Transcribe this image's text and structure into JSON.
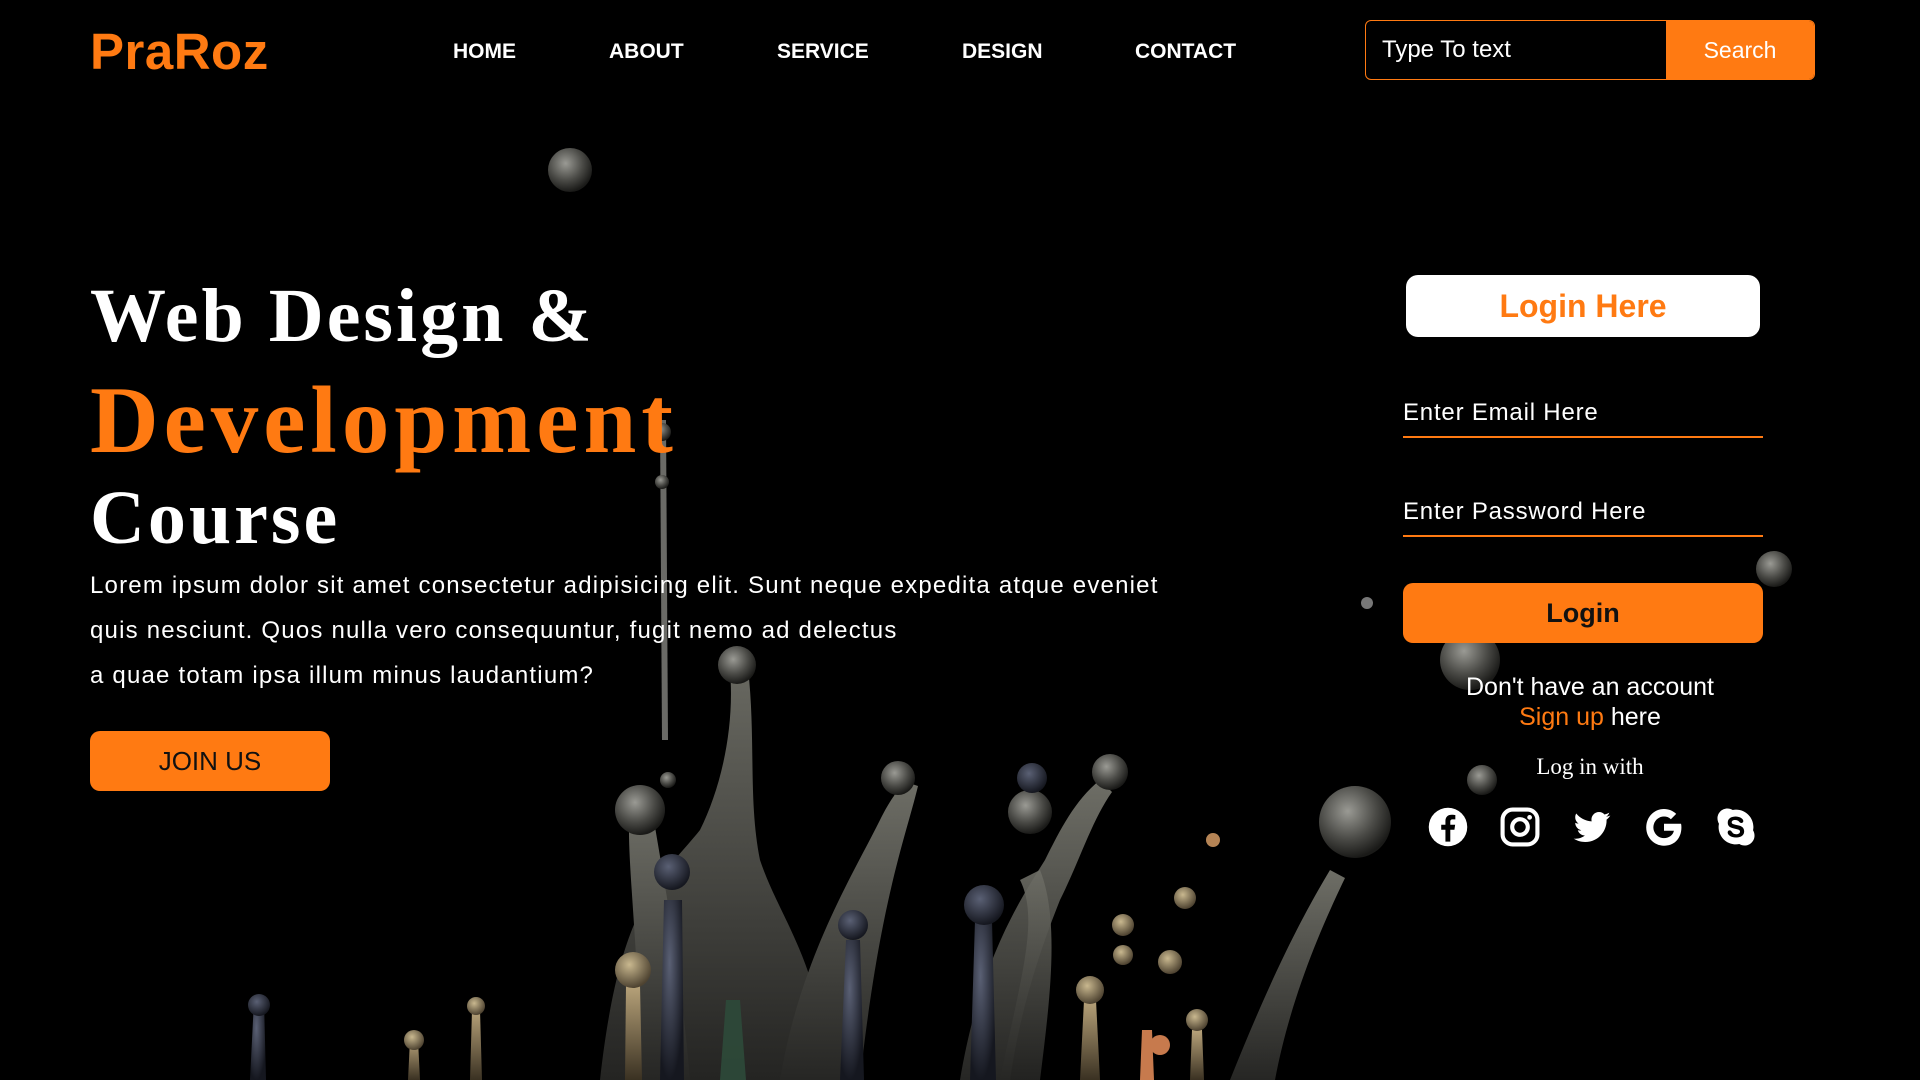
{
  "header": {
    "logo": "PraRoz",
    "nav": [
      {
        "label": "HOME"
      },
      {
        "label": "ABOUT"
      },
      {
        "label": "SERVICE"
      },
      {
        "label": "DESIGN"
      },
      {
        "label": "CONTACT"
      }
    ],
    "search": {
      "placeholder": "Type To text",
      "value": "",
      "button_label": "Search"
    }
  },
  "hero": {
    "line1": "Web Design &",
    "line2": "Development",
    "line3": "Course",
    "paragraph": [
      "Lorem ipsum dolor sit amet consectetur adipisicing elit. Sunt neque expedita atque eveniet",
      "quis nesciunt. Quos nulla vero consequuntur, fugit nemo ad delectus",
      "a quae totam ipsa illum minus laudantium?"
    ],
    "cta_label": "JOIN US"
  },
  "login": {
    "title": "Login Here",
    "email_placeholder": "Enter Email Here",
    "password_placeholder": "Enter Password Here",
    "button_label": "Login",
    "no_account_text": "Don't have an account",
    "signup_link": "Sign up",
    "signup_suffix": " here",
    "log_with": "Log in with",
    "social_icons": [
      "facebook-icon",
      "instagram-icon",
      "twitter-icon",
      "google-icon",
      "skype-icon"
    ]
  },
  "colors": {
    "accent": "#ff7a12",
    "background": "#000000",
    "text": "#ffffff"
  }
}
